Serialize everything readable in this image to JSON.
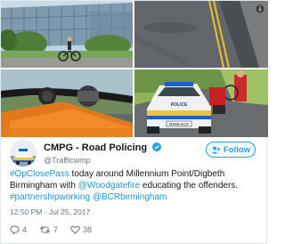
{
  "photos": {
    "police_car_plate": "BX66 KCX",
    "police_car_text": "POLICE"
  },
  "account": {
    "display_name": "CMPG - Road Policing",
    "handle": "@Trafficwmp"
  },
  "follow_label": "Follow",
  "tweet": {
    "seg1": "#OpClosePass",
    "seg2": " today around Millennium Point/Digbeth Birmingham with ",
    "seg3": "@Woodgatefire",
    "seg4": " educating the offenders.",
    "seg5": "#partnershipworking",
    "seg6": " ",
    "seg7": "@BCRbirmingham"
  },
  "timestamp": "12:50 PM - Jul 25, 2017",
  "actions": {
    "replies": "4",
    "retweets": "7",
    "likes": "38"
  },
  "colors": {
    "link": "#1b95e0",
    "follow": "#1da1f2",
    "muted": "#657786"
  },
  "icons": [
    "verified-icon",
    "follow-person-icon",
    "reply-icon",
    "retweet-icon",
    "like-icon",
    "info-icon"
  ]
}
